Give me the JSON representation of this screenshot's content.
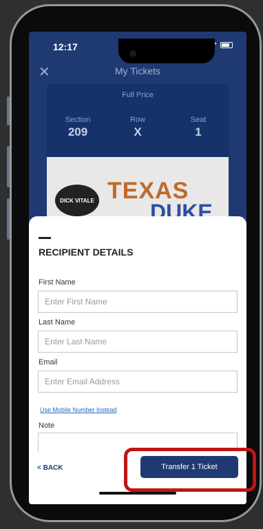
{
  "status": {
    "time": "12:17"
  },
  "nav": {
    "title": "My Tickets"
  },
  "ticket": {
    "price_type": "Full Price",
    "section_label": "Section",
    "section_value": "209",
    "row_label": "Row",
    "row_value": "X",
    "seat_label": "Seat",
    "seat_value": "1",
    "image_texts": {
      "logo": "DICK VITALE",
      "top": "TEXAS",
      "bottom": "DUKE"
    }
  },
  "recipient": {
    "heading": "RECIPIENT DETAILS",
    "first_name_label": "First Name",
    "first_name_placeholder": "Enter First Name",
    "last_name_label": "Last Name",
    "last_name_placeholder": "Enter Last Name",
    "email_label": "Email",
    "email_placeholder": "Enter Email Address",
    "mobile_link": "Use Mobile Number Instead",
    "note_label": "Note"
  },
  "footer": {
    "back_label": "< BACK",
    "transfer_label": "Transfer 1 Ticket"
  }
}
